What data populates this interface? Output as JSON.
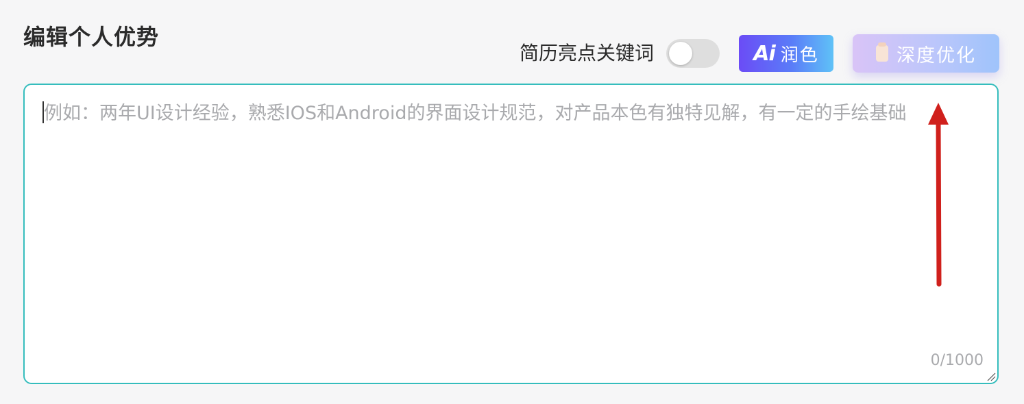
{
  "section": {
    "title": "编辑个人优势"
  },
  "toolbar": {
    "keyword_label": "简历亮点关键词",
    "keyword_toggle_on": false,
    "polish_icon_text": "Ai",
    "polish_label": "润色",
    "deep_optimize_label": "深度优化"
  },
  "editor": {
    "placeholder": "例如：两年UI设计经验，熟悉IOS和Android的界面设计规范，对产品本色有独特见解，有一定的手绘基础",
    "value": "",
    "counter": "0/1000"
  },
  "colors": {
    "editor_border": "#35bdbd",
    "annotation_arrow": "#d0201c",
    "polish_gradient_start": "#6b4cf6",
    "polish_gradient_end": "#5fc2f7"
  }
}
